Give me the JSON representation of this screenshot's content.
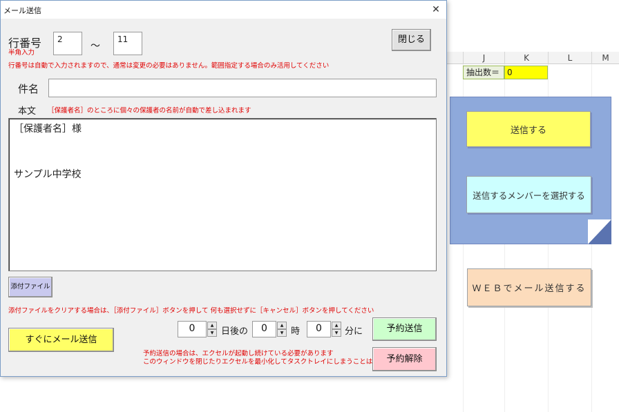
{
  "sheet": {
    "columns": [
      "J",
      "K",
      "L",
      "M"
    ],
    "extract_label": "抽出数＝",
    "extract_value": "0",
    "send_button": "送信する",
    "select_members_button": "送信するメンバーを選択する",
    "web_send_button": "ＷＥＢでメール送信する",
    "colors": {
      "panel": "#8ea9db",
      "send": "#ffff66",
      "members": "#ccffff",
      "web": "#fcdcbc"
    }
  },
  "dialog": {
    "title": "メール送信",
    "close_icon": "close-icon",
    "row_label": "行番号",
    "row_hint": "半角入力",
    "row_from": "2",
    "row_tilde": "～",
    "row_to": "11",
    "close_button": "閉じる",
    "row_note": "行番号は自動で入力されますので、通常は変更の必要はありません。範囲指定する場合のみ活用してください",
    "subject_label": "件名",
    "subject_value": "",
    "body_label": "本文",
    "body_note": "［保護者名］のところに個々の保護者の名前が自動で差し込まれます",
    "body_lines": [
      "［保護者名］様",
      "",
      "",
      "サンプル中学校"
    ],
    "attach_button": "添付ファイル",
    "attach_note": "添付ファイルをクリアする場合は、［添付ファイル］ボタンを押して 何も選択せずに［キャンセル］ボタンを押してください",
    "send_now_button": "すぐにメール送信",
    "days_value": "0",
    "days_unit": "日後の",
    "hours_value": "0",
    "hours_unit": "時",
    "minutes_value": "0",
    "minutes_unit": "分に",
    "reserve_note_1": "予約送信の場合は、エクセルが起動し続けている必要があります",
    "reserve_note_2": "このウィンドウを閉じたりエクセルを最小化してタスクトレイにしまうことはできます",
    "reserve_send_button": "予約送信",
    "reserve_cancel_button": "予約解除",
    "colors": {
      "send_now": "#ffff66",
      "reserve_send": "#ccffcc",
      "reserve_cancel": "#ffc7ce",
      "attach": "#c9c9ee",
      "note_red": "#e00000"
    }
  }
}
